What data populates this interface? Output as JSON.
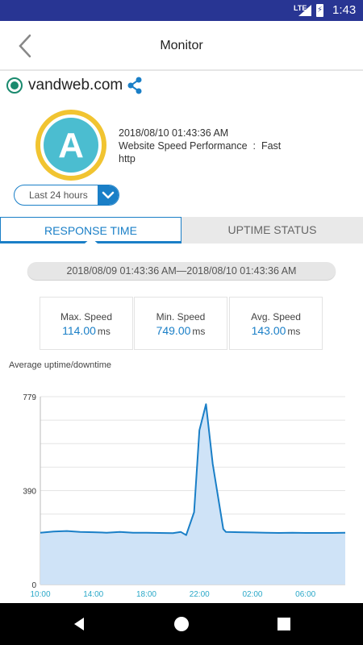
{
  "status_bar": {
    "network": "LTE",
    "time": "1:43"
  },
  "app_bar": {
    "title": "Monitor",
    "back_icon": "chevron-left-icon"
  },
  "site": {
    "domain": "vandweb.com",
    "status_color": "#1a8a6e",
    "share_icon": "share-icon"
  },
  "grade": {
    "letter": "A",
    "ring_color": "#f1c431",
    "fill_color": "#4bbdd0"
  },
  "info": {
    "timestamp": "2018/08/10 01:43:36 AM",
    "performance": "Website Speed Performance  :  Fast",
    "protocol": "http"
  },
  "range_select": {
    "value": "Last 24 hours",
    "icon": "chevron-down-icon"
  },
  "tabs": [
    {
      "label": "RESPONSE TIME",
      "active": true
    },
    {
      "label": "UPTIME STATUS",
      "active": false
    }
  ],
  "date_range": "2018/08/09 01:43:36 AM—2018/08/10 01:43:36 AM",
  "stats": [
    {
      "name": "Max. Speed",
      "value": "114.00",
      "unit": "ms"
    },
    {
      "name": "Min. Speed",
      "value": "749.00",
      "unit": "ms"
    },
    {
      "name": "Avg. Speed",
      "value": "143.00",
      "unit": "ms"
    }
  ],
  "chart_title": "Average uptime/downtime",
  "chart_data": {
    "type": "area",
    "ylim": [
      0,
      779
    ],
    "y_ticks": [
      "779",
      "390",
      "0"
    ],
    "y_tick_values": [
      779,
      390,
      0
    ],
    "x_ticks": [
      "10:00",
      "14:00",
      "18:00",
      "22:00",
      "02:00",
      "06:00"
    ],
    "x_tick_hours": [
      10,
      14,
      18,
      22,
      26,
      30
    ],
    "x_range_hours": [
      10,
      33
    ],
    "grid": true,
    "line_color": "#1a7fc7",
    "fill_color": "#cfe3f7",
    "series": [
      {
        "x_hours": [
          10,
          11,
          12,
          13,
          14,
          15,
          16,
          17,
          18,
          19,
          20,
          20.6,
          21,
          21.6,
          22,
          22.5,
          23,
          23.8,
          24,
          25,
          26,
          27,
          28,
          29,
          30,
          31,
          32,
          33
        ],
        "values": [
          215,
          220,
          222,
          218,
          217,
          215,
          218,
          215,
          215,
          214,
          213,
          218,
          205,
          300,
          640,
          748,
          500,
          230,
          218,
          217,
          216,
          215,
          214,
          215,
          214,
          214,
          214,
          215
        ]
      }
    ]
  },
  "nav": {
    "back_icon": "nav-back-icon",
    "home_icon": "nav-home-icon",
    "recents_icon": "nav-recents-icon"
  }
}
